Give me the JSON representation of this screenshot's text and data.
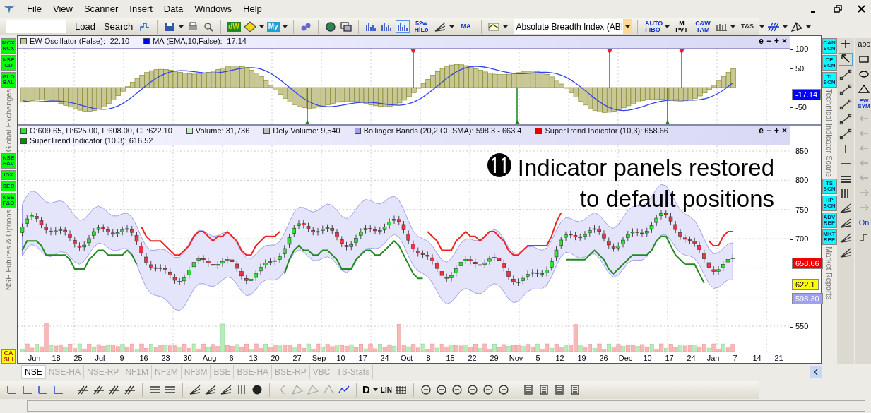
{
  "menu": [
    "File",
    "View",
    "Scanner",
    "Insert",
    "Data",
    "Windows",
    "Help"
  ],
  "toolbar": {
    "search_buttons": [
      "Load",
      "Search"
    ],
    "icon_labels": [
      "dW",
      "My",
      "52w HiLo",
      "MA"
    ],
    "indicator_select": {
      "value": "Absolute Breadth Index (ABI"
    },
    "right_labels": [
      "AUTO FIBO",
      "M PVT",
      "C&W TAM",
      "T&S"
    ]
  },
  "left_strip": [
    {
      "kind": "button",
      "label": "MCX NCX",
      "color": "#00ff00"
    },
    {
      "kind": "button",
      "label": "NSE CD",
      "color": "#00ff00"
    },
    {
      "kind": "button",
      "label": "GLO BAL",
      "color": "#00ff00"
    },
    {
      "kind": "label",
      "label": "Global Exchanges"
    },
    {
      "kind": "button",
      "label": "NSE F&V",
      "color": "#00ff00"
    },
    {
      "kind": "button",
      "label": "IDX",
      "color": "#00ff00"
    },
    {
      "kind": "button",
      "label": "SEC",
      "color": "#00ff00"
    },
    {
      "kind": "button",
      "label": "NSE F&O",
      "color": "#00ff00"
    },
    {
      "kind": "label",
      "label": "NSE Futures & Options"
    }
  ],
  "bottom_left_button": {
    "label": "CA SLI",
    "color": "#ffff00"
  },
  "oscillator_panel": {
    "legend": [
      {
        "color": "#c8c896",
        "text": "EW Oscillator (False): -22.10"
      },
      {
        "color": "#0000ff",
        "text": "MA (EMA,10,False): -17.14"
      }
    ],
    "controls": [
      "e",
      "−",
      "+",
      "×"
    ],
    "yticks": [
      "100",
      "50",
      "-50"
    ],
    "badge": {
      "text": "-17.14",
      "color": "#0000ff"
    }
  },
  "price_panel": {
    "legend": [
      {
        "color": "#33dd33",
        "text": "O:609.65, H:625.00, L:608.00, CL:622.10"
      },
      {
        "color": "#c8ecc8",
        "text": "Volume: 31,736"
      },
      {
        "color": "#c0c0c0",
        "text": "Dely Volume: 9,540"
      },
      {
        "color": "#a0a0f0",
        "text": "Bollinger Bands (20,2,CL,SMA): 598.3 - 663.4"
      },
      {
        "color": "#ee0000",
        "text": "SuperTrend Indicator (10,3): 658.66"
      },
      {
        "color": "#118811",
        "text": "SuperTrend Indicator (10,3): 616.52"
      }
    ],
    "controls": [
      "e",
      "−",
      "+",
      "×"
    ],
    "yticks": [
      "850",
      "800",
      "750",
      "700",
      "550"
    ],
    "badges": [
      {
        "text": "658.66",
        "color": "#ee0000"
      },
      {
        "text": "622.1",
        "color": "#ffff00"
      },
      {
        "text": "598.30",
        "color": "#a0a0f0"
      }
    ],
    "annotation": {
      "number": "⓫",
      "lines": [
        "Indicator panels restored",
        "to default positions"
      ]
    }
  },
  "xticks": [
    "Jun",
    "18",
    "25",
    "Jul",
    "9",
    "16",
    "23",
    "30",
    "Aug",
    "6",
    "13",
    "20",
    "27",
    "Sep",
    "10",
    "17",
    "24",
    "Oct",
    "8",
    "15",
    "22",
    "29",
    "Nov",
    "5",
    "12",
    "19",
    "26",
    "Dec",
    "10",
    "17",
    "24",
    "Jan",
    "7",
    "14",
    "21"
  ],
  "right_strip": [
    {
      "kind": "button",
      "label": "CAN SCN",
      "color": "#00ffff"
    },
    {
      "kind": "button",
      "label": "CP SCN",
      "color": "#00ffff"
    },
    {
      "kind": "button",
      "label": "TI SCN",
      "color": "#00ffff"
    },
    {
      "kind": "label",
      "label": "Technical Indicator Scans"
    },
    {
      "kind": "button",
      "label": "TS SCN",
      "color": "#00ffff"
    },
    {
      "kind": "button",
      "label": "HP SCN",
      "color": "#00ffff"
    },
    {
      "kind": "button",
      "label": "ADV REP",
      "color": "#00ffff"
    },
    {
      "kind": "button",
      "label": "MKT REP",
      "color": "#00ffff"
    },
    {
      "kind": "label",
      "label": "Market Reports"
    }
  ],
  "tool_labels": [
    "abc",
    "EW SYM",
    "On"
  ],
  "tabs": [
    {
      "label": "NSE",
      "selected": true
    },
    {
      "label": "NSE-HA",
      "selected": false
    },
    {
      "label": "NSE-RP",
      "selected": false
    },
    {
      "label": "NF1M",
      "selected": false
    },
    {
      "label": "NF2M",
      "selected": false
    },
    {
      "label": "NF3M",
      "selected": false
    },
    {
      "label": "BSE",
      "selected": false
    },
    {
      "label": "BSE-HA",
      "selected": false
    },
    {
      "label": "BSE-RP",
      "selected": false
    },
    {
      "label": "VBC",
      "selected": false
    },
    {
      "label": "TS-Stats",
      "selected": false
    }
  ],
  "bottom_toolbar": {
    "labels": [
      "D",
      "LIN"
    ]
  }
}
